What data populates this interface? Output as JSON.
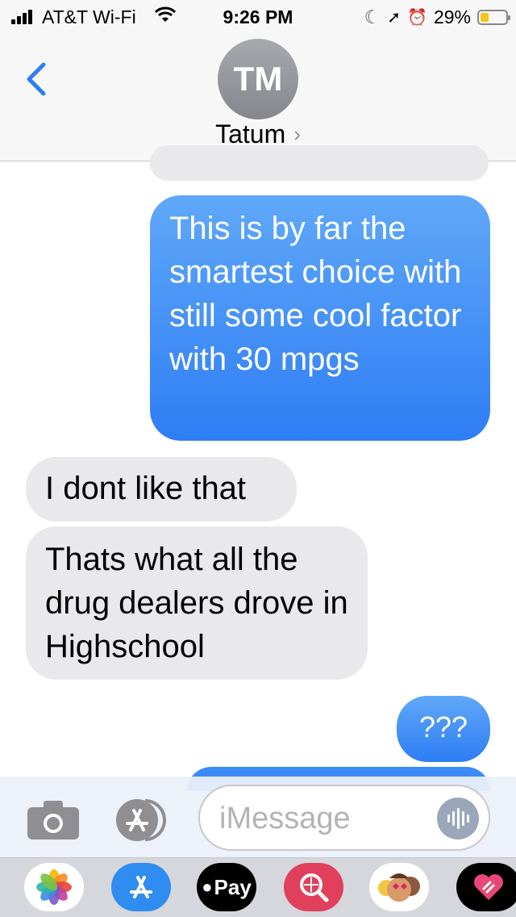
{
  "status_bar": {
    "carrier": "AT&T Wi-Fi",
    "time": "9:26 PM",
    "battery": "29%",
    "battery_level": 0.29
  },
  "header": {
    "avatar_initials": "TM",
    "contact_name": "Tatum",
    "chevron": "›"
  },
  "messages": [
    {
      "type": "sent",
      "text": "This is by far the smartest choice with still some cool factor with 30 mpgs"
    },
    {
      "type": "received",
      "text": "I dont like that"
    },
    {
      "type": "received",
      "text": "Thats what all the drug dealers drove in Highschool"
    },
    {
      "type": "sent",
      "text": "???"
    }
  ],
  "composer": {
    "placeholder": "iMessage"
  },
  "tray": {
    "pay_label": "Pay",
    "icons": [
      "photos-icon",
      "app-store-icon",
      "apple-pay-icon",
      "web-search-icon",
      "memoji-icon",
      "digital-touch-icon"
    ]
  },
  "colors": {
    "sent_bubble": "#3b8af6",
    "received_bubble": "#e9e9eb",
    "ios_blue": "#2f7df5"
  }
}
